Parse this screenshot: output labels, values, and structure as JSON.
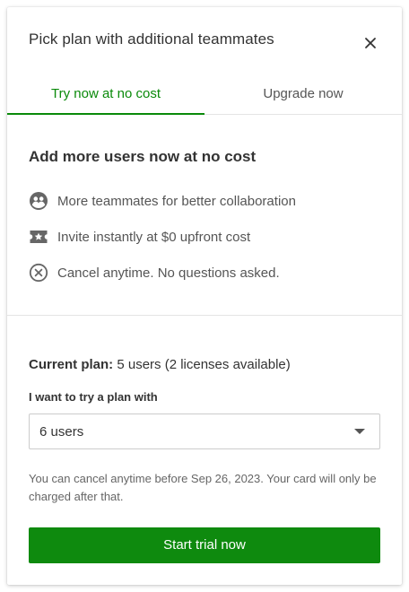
{
  "dialog": {
    "title": "Pick plan with additional teammates"
  },
  "tabs": [
    {
      "label": "Try now at no cost",
      "active": true
    },
    {
      "label": "Upgrade now",
      "active": false
    }
  ],
  "section": {
    "title": "Add more users now at no cost",
    "features": [
      {
        "icon": "teammates-icon",
        "text": "More teammates for better collaboration"
      },
      {
        "icon": "ticket-star-icon",
        "text": "Invite instantly at $0 upfront cost"
      },
      {
        "icon": "cancel-circle-icon",
        "text": "Cancel anytime. No questions asked."
      }
    ]
  },
  "plan": {
    "current_label": "Current plan:",
    "current_value": "5 users (2 licenses available)",
    "try_label": "I want to try a plan with",
    "selected_option": "6 users",
    "note": "You can cancel anytime before Sep 26, 2023. Your card will only be charged after that.",
    "cta_label": "Start trial now"
  },
  "colors": {
    "accent": "#0e8a0e",
    "text": "#333333",
    "muted": "#666666"
  }
}
